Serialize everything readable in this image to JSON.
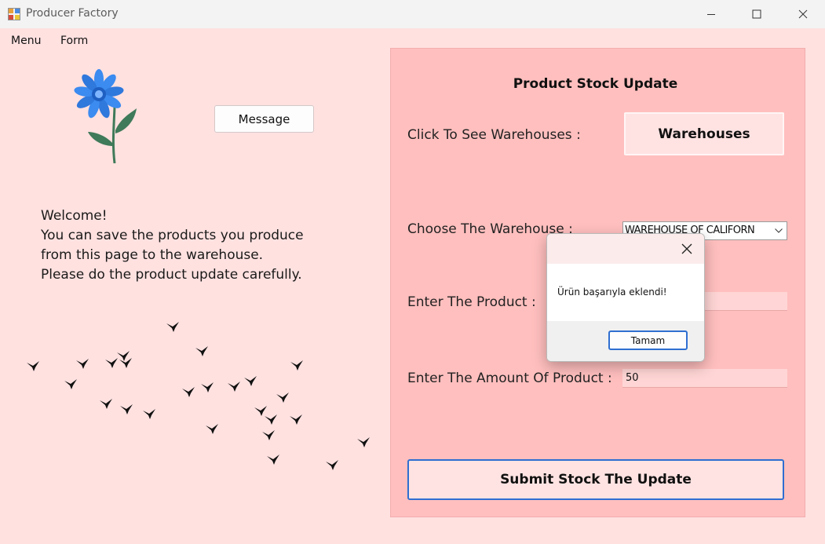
{
  "window": {
    "title": "Producer Factory",
    "icon": "app-windows-icon",
    "controls": [
      "minimize-icon",
      "maximize-icon",
      "close-icon"
    ]
  },
  "menu": {
    "items": [
      "Menu",
      "Form"
    ]
  },
  "left": {
    "message_button": "Message",
    "welcome_lines": [
      "Welcome!",
      "You can save the products you produce",
      "from this page to the warehouse.",
      "Please do the product update carefully."
    ],
    "decorations": [
      "blue-flower-illustration",
      "flying-birds-illustration"
    ]
  },
  "panel": {
    "title": "Product Stock Update",
    "warehouses_label": "Click To See Warehouses :",
    "warehouses_button": "Warehouses",
    "choose_label": "Choose The Warehouse :",
    "selected_warehouse": "WAREHOUSE OF CALIFORN",
    "product_label": "Enter The Product :",
    "product_value": "",
    "amount_label": "Enter The Amount Of Product :",
    "amount_value": "50",
    "submit_button": "Submit Stock The Update"
  },
  "dialog": {
    "message": "Ürün başarıyla eklendi!",
    "ok_button": "Tamam"
  },
  "colors": {
    "window_bg": "#ffe1e0",
    "panel_bg": "#ffbfbe",
    "button_bg": "#ffe3e2",
    "accent_blue": "#2f6fd1",
    "flower_blue": "#3b8bf0",
    "leaf_green": "#3f7a5a"
  }
}
